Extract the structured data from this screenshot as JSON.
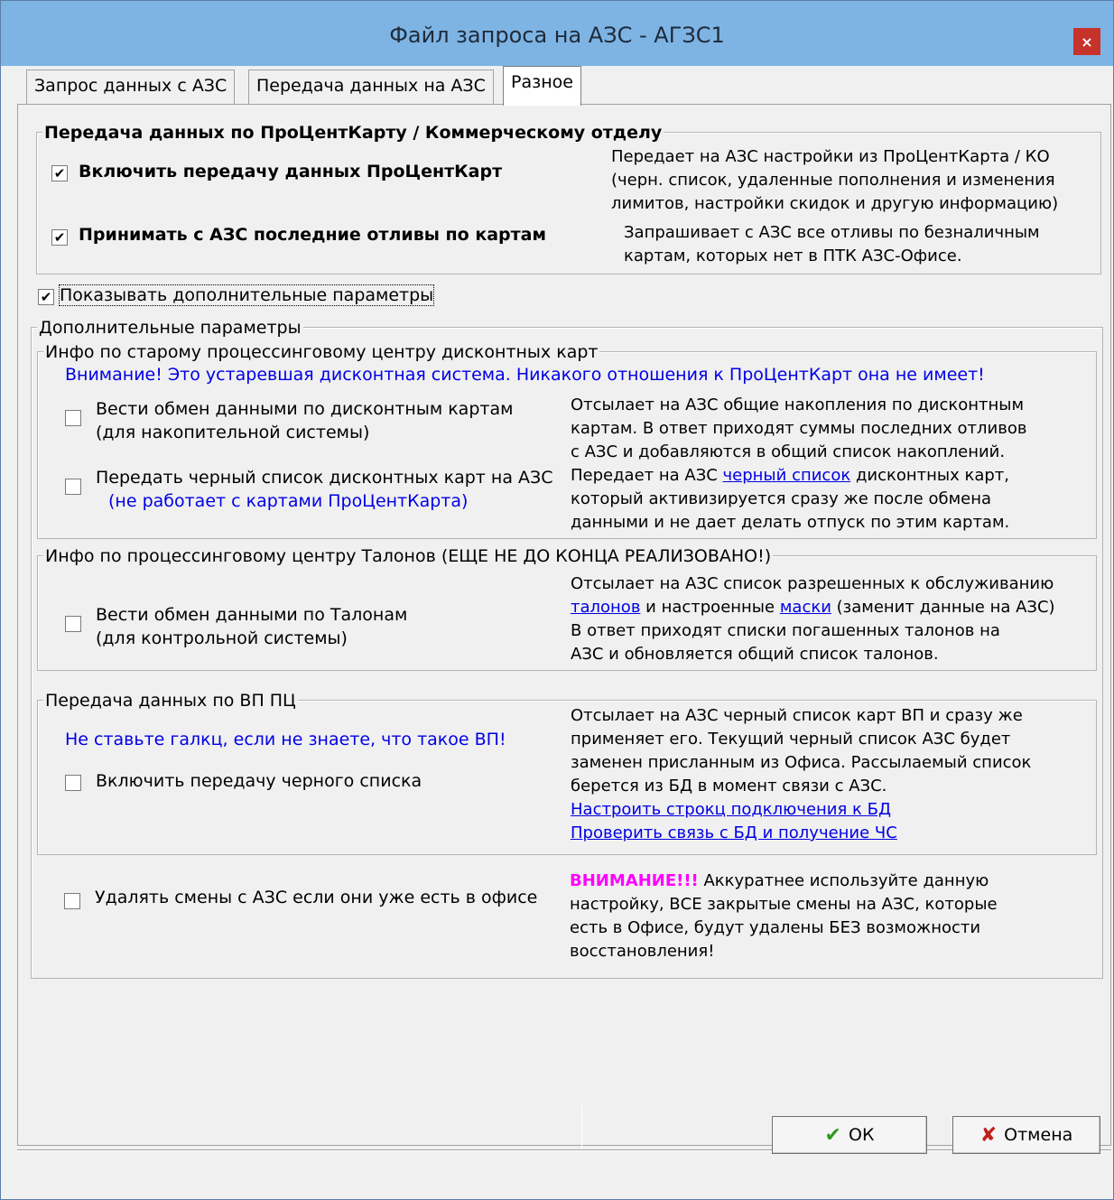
{
  "window": {
    "title": "Файл запроса на АЗС - АГЗС1",
    "close_label": "×"
  },
  "tabs": [
    {
      "label": "Запрос данных с АЗС"
    },
    {
      "label": "Передача данных на АЗС"
    },
    {
      "label": "Разное",
      "active": true
    }
  ],
  "procentcart": {
    "legend": "Передача данных по ПроЦентКарту / Коммерческому отделу",
    "enable": {
      "label": "Включить передачу данных ПроЦентКарт",
      "checked": true
    },
    "enable_desc": [
      "Передает на АЗС настройки из ПроЦентКарта / КО",
      "(черн. список, удаленные пополнения и изменения",
      "лимитов, настройки скидок и другую информацию)"
    ],
    "receive": {
      "label": "Принимать с АЗС последние отливы по картам",
      "checked": true
    },
    "receive_desc": [
      "Запрашивает с АЗС все отливы по безналичным",
      "картам, которых нет в ПТК АЗС-Офисе."
    ]
  },
  "show_extra": {
    "label": "Показывать дополнительные параметры",
    "checked": true
  },
  "extra": {
    "legend": "Дополнительные параметры",
    "old_center": {
      "legend": "Инфо по старому процессинговому центру дисконтных карт",
      "warning": "Внимание! Это устаревшая дисконтная система. Никакого отношения к ПроЦентКарт она не имеет!",
      "exchange": {
        "label_1": "Вести обмен данными по дисконтным картам",
        "label_2": "(для накопительной системы)",
        "checked": false
      },
      "exchange_desc": [
        "Отсылает на АЗС общие накопления по дисконтным",
        "картам. В ответ приходят суммы последних отливов",
        "с АЗС и добавляются в общий список накоплений."
      ],
      "blacklist": {
        "label_1": "Передать черный список дисконтных карт на АЗС",
        "label_2": "(не работает с картами ПроЦентКарта)",
        "checked": false
      },
      "blacklist_desc_1a": "Передает на АЗС ",
      "blacklist_desc_link": "черный список",
      "blacklist_desc_1b": " дисконтных карт,",
      "blacklist_desc_2": "который активизируется сразу же после обмена",
      "blacklist_desc_3": "данными и не дает делать отпуск по этим картам."
    },
    "talons": {
      "legend": "Инфо по процессинговому центру Талонов (ЕЩЕ НЕ ДО КОНЦА РЕАЛИЗОВАНО!)",
      "exchange": {
        "label_1": "Вести обмен данными по Талонам",
        "label_2": "(для контрольной системы)",
        "checked": false
      },
      "desc_1": "Отсылает на АЗС список разрешенных к обслуживанию",
      "desc_2_link1": "талонов",
      "desc_2_mid": " и настроенные ",
      "desc_2_link2": "маски",
      "desc_2_end": " (заменит данные на АЗС)",
      "desc_3": "В ответ приходят списки погашенных талонов на",
      "desc_4": "АЗС и обновляется общий список талонов."
    },
    "vp": {
      "legend": "Передача данных по ВП ПЦ",
      "warning": "Не ставьте галкц, если не знаете, что такое ВП!",
      "enable": {
        "label": "Включить передачу черного списка",
        "checked": false
      },
      "desc": [
        "Отсылает на АЗС черный список карт ВП и сразу же",
        "применяет его. Текущий черный список АЗС будет",
        "заменен присланным из Офиса. Рассылаемый список",
        "берется из БД в момент связи с АЗС."
      ],
      "link_conn": "Настроить строкц подключения к БД",
      "link_check": "Проверить связь с БД и получение ЧС"
    },
    "delete_shifts": {
      "label": "Удалять смены с АЗС если они уже есть в офисе",
      "checked": false
    },
    "delete_warn": "ВНИМАНИЕ!!!",
    "delete_desc_1": " Аккуратнее используйте данную",
    "delete_desc": [
      "настройку, ВСЕ закрытые смены на АЗС, которые",
      "есть в Офисе, будут удалены БЕЗ возможности",
      "восстановления!"
    ]
  },
  "buttons": {
    "ok": "ОК",
    "cancel": "Отмена"
  },
  "colors": {
    "titlebar": "#7eb4e4",
    "close": "#c7322b",
    "link": "#0000e6",
    "warn": "#ff00ff"
  },
  "icons": {
    "ok": "checkmark-icon",
    "cancel": "x-icon"
  }
}
